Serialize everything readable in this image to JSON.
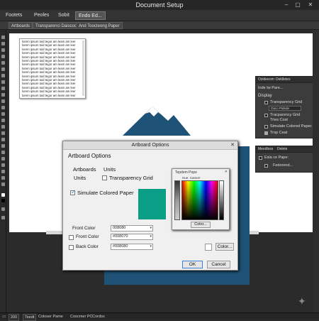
{
  "window": {
    "title": "Document Setup",
    "minimize": "–",
    "maximize": "▢",
    "close": "✕"
  },
  "menubar": {
    "items": [
      "Footets",
      "Peoles",
      "Sobit",
      "Endo Ed..."
    ]
  },
  "doc_tabs": [
    "Artboards",
    "Transparenci Daiscoor",
    "And Toocteong Paper"
  ],
  "text_frame": {
    "lines": [
      "lorem ipsum toid tegor am leam am leer",
      "lorem ipsum toid tegor am leam am leer",
      "lorem ipsum toid tegor am leam am leer",
      "lorem ipsum toid tegor am leam am leer",
      "lorem ipsum toid tegor am leam am leer",
      "lorem ipsum toid tegor am leam am leer",
      "lorem ipsum toid tegor am leam am leer",
      "lorem ipsum toid tegor am leam am leer",
      "lorem ipsum toid tegor am leam am leer",
      "lorem ipsum toid tegor am leam am leer",
      "lorem ipsum toid tegor am leam am leer",
      "lorem ipsum toid tegor am leam am leer",
      "lorem ipsum toid tegor am leam am leer",
      "lorem ipsum toid tegor am leam am leer",
      "lorem ipsum toid tegor am leam am leer"
    ]
  },
  "dialog": {
    "title": "Artboard Options",
    "close": "✕",
    "heading": "Artboard Options",
    "artboards_label": "Artboards",
    "units_label": "Units",
    "units_row_label": "Units",
    "transparency_grid_label": "Transparency Grid",
    "simulate_paper_label": "Simulate Colored Paper",
    "simulate_paper_checked": true,
    "front_color_label": "Front Color",
    "front_color_value": "008080",
    "front_color_2_label": "Front Color",
    "front_color_2_value": "#008070",
    "back_color_label": "Back Color",
    "back_color_value": "#008080",
    "color_button": "Color...",
    "ok_button": "OK",
    "cancel_button": "Cancel",
    "swatch_color": "#0a9e86"
  },
  "color_picker": {
    "title": "Tepdem Pope",
    "label": "Hue. Camer!",
    "close": "✕",
    "color_button": "Color..."
  },
  "panel_display": {
    "tabs": [
      "Ozideeom",
      "Deklletes"
    ],
    "header": "Inde tw Pare...",
    "section": "Display",
    "rows": [
      "Transparency Grid",
      "Oaco Pidede",
      "Tracparency Grid",
      "Tries Cost",
      "Simulate Colored Paper...",
      "Trop Ceat"
    ]
  },
  "panel_artboard": {
    "tabs": [
      "Meedloss",
      "Delete"
    ],
    "row1": "Esla ce Pape:",
    "row2": "Fedorend..."
  },
  "statusbar": {
    "zoom": "200",
    "items": [
      "Teedt",
      "Coloser Pame",
      "Coocmer PC",
      "Cordos"
    ]
  }
}
